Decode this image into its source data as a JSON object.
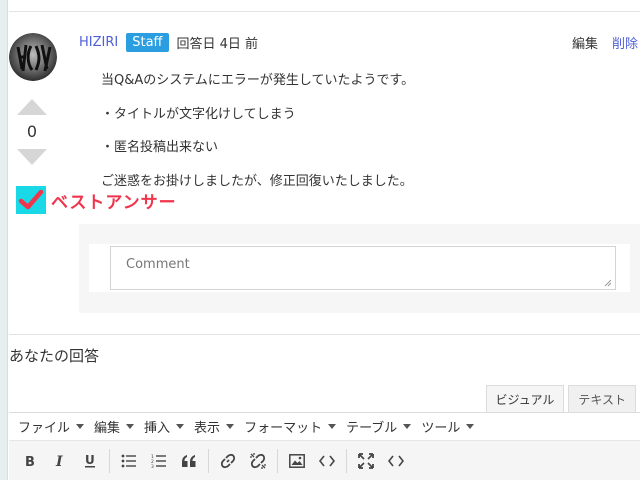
{
  "answer": {
    "author": "HIZIRI",
    "badge": "Staff",
    "answered_label": "回答日 4日 前",
    "actions": {
      "edit": "編集",
      "delete": "削除"
    },
    "votes": "0",
    "best_answer_label": "ベストアンサー",
    "paragraphs": [
      "当Q&Aのシステムにエラーが発生していたようです。",
      "・タイトルが文字化けしてしまう",
      "・匿名投稿出来ない",
      "ご迷惑をお掛けしましたが、修正回復いたしました。"
    ],
    "comment_placeholder": "Comment"
  },
  "your_answer": {
    "heading": "あなたの回答",
    "tabs": [
      {
        "label": "ビジュアル",
        "active": true
      },
      {
        "label": "テキスト",
        "active": false
      }
    ],
    "menus": [
      "ファイル",
      "編集",
      "挿入",
      "表示",
      "フォーマット",
      "テーブル",
      "ツール"
    ],
    "toolbar_icons": [
      "bold-icon",
      "italic-icon",
      "underline-icon",
      "bullet-list-icon",
      "numbered-list-icon",
      "blockquote-icon",
      "link-icon",
      "unlink-icon",
      "image-icon",
      "code-icon",
      "fullscreen-icon",
      "source-code-icon"
    ]
  },
  "colors": {
    "author": "#4f5fd8",
    "badge": "#2a9ee0",
    "best_answer_text": "#f0344c",
    "best_answer_check_bg": "#19d9e6"
  }
}
